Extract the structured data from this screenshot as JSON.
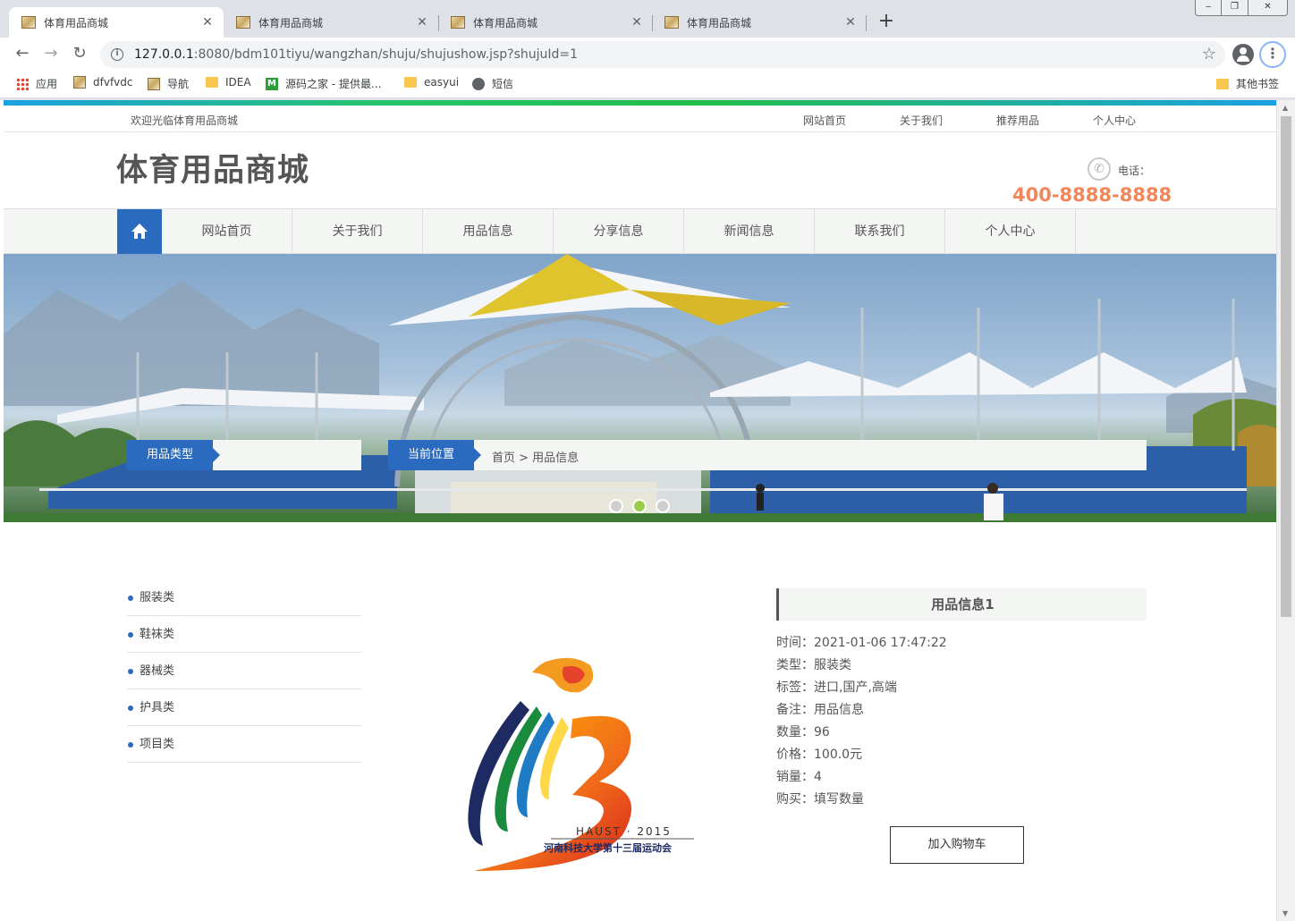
{
  "browser": {
    "tabs": [
      {
        "title": "体育用品商城",
        "active": true
      },
      {
        "title": "体育用品商城",
        "active": false
      },
      {
        "title": "体育用品商城",
        "active": false
      },
      {
        "title": "体育用品商城",
        "active": false
      }
    ],
    "tab_close_glyph": "✕",
    "new_tab_glyph": "+",
    "window_buttons": [
      "‒",
      "❐",
      "✕"
    ],
    "back_glyph": "←",
    "forward_glyph": "→",
    "reload_glyph": "↻",
    "url_host": "127.0.0.1",
    "url_path": ":8080/bdm101tiyu/wangzhan/shuju/shujushow.jsp?shujuId=1",
    "star_glyph": "☆",
    "menu_glyph": "⋮",
    "bookmarks": [
      {
        "label": "应用",
        "icon": "apps-icon"
      },
      {
        "label": "dfvfvdc",
        "icon": "page-favicon-icon"
      },
      {
        "label": "导航",
        "icon": "page-favicon-icon"
      },
      {
        "label": "IDEA",
        "icon": "folder-icon"
      },
      {
        "label": "源码之家 - 提供最...",
        "icon": "m-logo-icon"
      },
      {
        "label": "easyui",
        "icon": "folder-icon"
      },
      {
        "label": "短信",
        "icon": "globe-icon"
      }
    ],
    "other_bookmarks": "其他书签"
  },
  "site": {
    "welcome": "欢迎光临体育用品商城",
    "top_links": [
      "网站首页",
      "关于我们",
      "推荐用品",
      "个人中心"
    ],
    "title": "体育用品商城",
    "phone_label": "电话：",
    "phone_number": "400-8888-8888",
    "nav": [
      "网站首页",
      "关于我们",
      "用品信息",
      "分享信息",
      "新闻信息",
      "联系我们",
      "个人中心"
    ],
    "banner_slides": 3,
    "banner_active_slide": 2
  },
  "sidebar": {
    "heading": "用品类型",
    "categories": [
      "服装类",
      "鞋袜类",
      "器械类",
      "护具类",
      "项目类"
    ]
  },
  "breadcrumb": {
    "label": "当前位置",
    "path": "首页 > 用品信息"
  },
  "detail": {
    "title": "用品信息1",
    "logo_text_en": "HAUST · 2015",
    "logo_text_cn": "河南科技大学第十三届运动会",
    "fields": [
      "时间：2021-01-06 17:47:22",
      "类型：服装类",
      "标签：进口,国产,高端",
      "备注：用品信息",
      "数量：96",
      "价格：100.0元",
      "销量：4",
      "购买：填写数量"
    ],
    "cart_button": "加入购物车"
  },
  "colors": {
    "brand_blue": "#2a6bbf",
    "phone_orange": "#f0875a",
    "slide_active": "#9ccc4a"
  }
}
